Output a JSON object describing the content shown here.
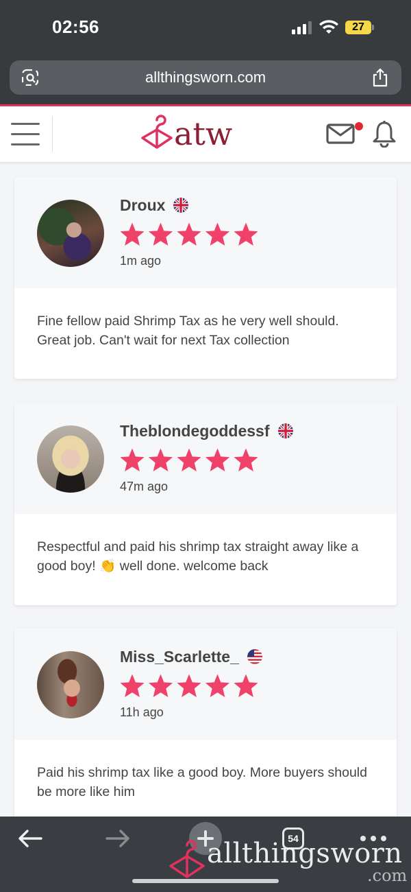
{
  "status_bar": {
    "time": "02:56",
    "battery": "27"
  },
  "browser": {
    "url": "allthingsworn.com"
  },
  "site": {
    "logo_text": "atw"
  },
  "reviews": [
    {
      "username": "Droux",
      "country": "uk",
      "rating": 5,
      "time": "1m ago",
      "text": "Fine fellow paid Shrimp Tax as he very well should. Great job. Can't wait for next Tax collection"
    },
    {
      "username": "Theblondegoddessf",
      "country": "uk",
      "rating": 5,
      "time": "47m ago",
      "text": "Respectful and paid his shrimp tax straight away like a good boy! 👏 well done. welcome back"
    },
    {
      "username": "Miss_Scarlette_",
      "country": "us",
      "rating": 5,
      "time": "11h ago",
      "text": "Paid his shrimp tax like a good boy. More buyers should be more like him"
    }
  ],
  "bottom_bar": {
    "tab_count": "54",
    "watermark": "allthingsworn",
    "watermark_suffix": ".com"
  },
  "colors": {
    "accent": "#e0315f",
    "star": "#f0416a",
    "logo": "#8a1f36"
  }
}
